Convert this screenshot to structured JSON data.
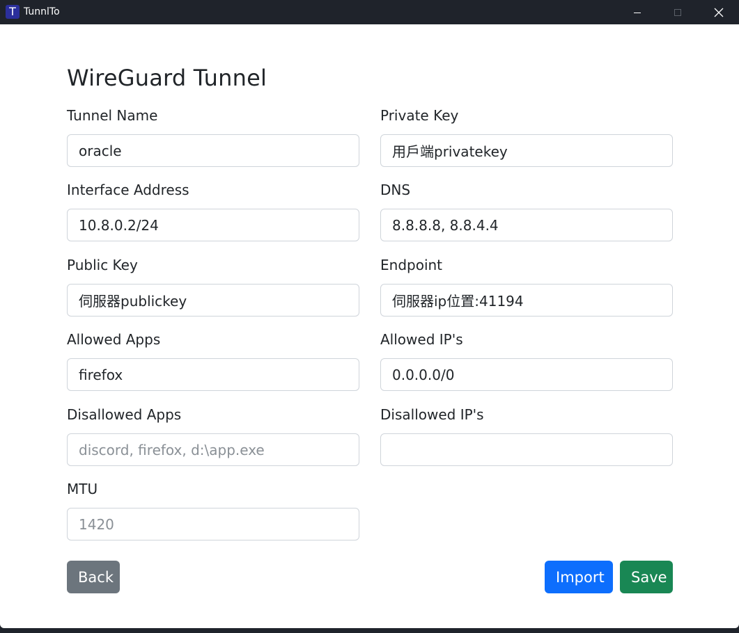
{
  "window": {
    "app_icon_letter": "T",
    "title": "TunnlTo",
    "controls": [
      "minimize-icon",
      "maximize-icon",
      "close-icon"
    ]
  },
  "form": {
    "title": "WireGuard Tunnel",
    "fields": {
      "tunnel_name": {
        "label": "Tunnel Name",
        "value": "oracle",
        "placeholder": ""
      },
      "private_key": {
        "label": "Private Key",
        "value": "用戶端privatekey",
        "placeholder": ""
      },
      "interface_address": {
        "label": "Interface Address",
        "value": "10.8.0.2/24",
        "placeholder": ""
      },
      "dns": {
        "label": "DNS",
        "value": "8.8.8.8, 8.8.4.4",
        "placeholder": ""
      },
      "public_key": {
        "label": "Public Key",
        "value": "伺服器publickey",
        "placeholder": ""
      },
      "endpoint": {
        "label": "Endpoint",
        "value": "伺服器ip位置:41194",
        "placeholder": ""
      },
      "allowed_apps": {
        "label": "Allowed Apps",
        "value": "firefox",
        "placeholder": ""
      },
      "allowed_ips": {
        "label": "Allowed IP's",
        "value": "0.0.0.0/0",
        "placeholder": ""
      },
      "disallowed_apps": {
        "label": "Disallowed Apps",
        "value": "",
        "placeholder": "discord, firefox, d:\\app.exe"
      },
      "disallowed_ips": {
        "label": "Disallowed IP's",
        "value": "",
        "placeholder": ""
      },
      "mtu": {
        "label": "MTU",
        "value": "",
        "placeholder": "1420"
      }
    },
    "buttons": {
      "back": "Back",
      "import": "Import",
      "save": "Save"
    }
  },
  "colors": {
    "titlebar": "#1f232b",
    "back": "#6c757d",
    "import": "#0d6efd",
    "save": "#198754"
  }
}
